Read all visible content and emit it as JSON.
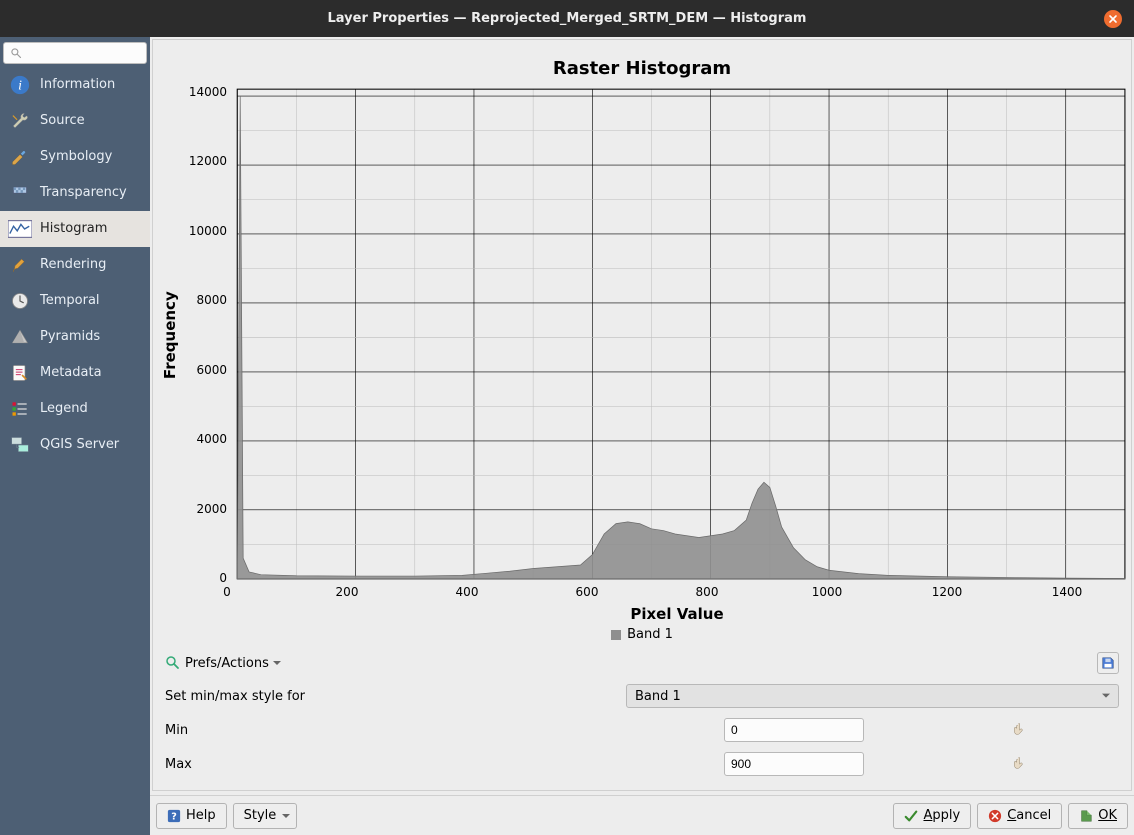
{
  "window_title": "Layer Properties — Reprojected_Merged_SRTM_DEM — Histogram",
  "sidebar": {
    "search_placeholder": "",
    "items": [
      {
        "label": "Information",
        "icon": "info-icon",
        "active": false
      },
      {
        "label": "Source",
        "icon": "wrench-icon",
        "active": false
      },
      {
        "label": "Symbology",
        "icon": "brush-icon",
        "active": false
      },
      {
        "label": "Transparency",
        "icon": "transparency-icon",
        "active": false
      },
      {
        "label": "Histogram",
        "icon": "histogram-icon",
        "active": true
      },
      {
        "label": "Rendering",
        "icon": "paint-icon",
        "active": false
      },
      {
        "label": "Temporal",
        "icon": "clock-icon",
        "active": false
      },
      {
        "label": "Pyramids",
        "icon": "pyramid-icon",
        "active": false
      },
      {
        "label": "Metadata",
        "icon": "metadata-icon",
        "active": false
      },
      {
        "label": "Legend",
        "icon": "legend-icon",
        "active": false
      },
      {
        "label": "QGIS Server",
        "icon": "server-icon",
        "active": false
      }
    ]
  },
  "chart_data": {
    "type": "area",
    "title": "Raster Histogram",
    "xlabel": "Pixel Value",
    "ylabel": "Frequency",
    "xlim": [
      0,
      1500
    ],
    "ylim": [
      0,
      14200
    ],
    "xticks": [
      0,
      200,
      400,
      600,
      800,
      1000,
      1200,
      1400
    ],
    "yticks": [
      0,
      2000,
      4000,
      6000,
      8000,
      10000,
      12000,
      14000
    ],
    "legend": "Band 1",
    "series": [
      {
        "name": "Band 1",
        "color": "#8f8f8f",
        "x": [
          0,
          5,
          10,
          20,
          40,
          100,
          200,
          300,
          380,
          420,
          460,
          500,
          540,
          580,
          600,
          620,
          640,
          660,
          680,
          700,
          720,
          740,
          760,
          780,
          800,
          820,
          840,
          860,
          870,
          880,
          890,
          900,
          910,
          920,
          940,
          960,
          980,
          1000,
          1050,
          1100,
          1200,
          1300,
          1400,
          1500
        ],
        "y": [
          0,
          14000,
          600,
          200,
          120,
          90,
          80,
          80,
          100,
          160,
          220,
          300,
          350,
          400,
          700,
          1300,
          1600,
          1650,
          1600,
          1450,
          1400,
          1300,
          1250,
          1200,
          1250,
          1300,
          1400,
          1700,
          2200,
          2600,
          2800,
          2650,
          2100,
          1500,
          900,
          550,
          350,
          250,
          150,
          100,
          60,
          40,
          20,
          10
        ]
      }
    ]
  },
  "controls": {
    "prefs_actions_label": "Prefs/Actions",
    "set_minmax_label": "Set min/max style for",
    "band_select_value": "Band 1",
    "min_label": "Min",
    "min_value": "0",
    "max_label": "Max",
    "max_value": "900"
  },
  "buttons": {
    "help": "Help",
    "style": "Style",
    "apply": "Apply",
    "cancel": "Cancel",
    "ok": "OK"
  }
}
